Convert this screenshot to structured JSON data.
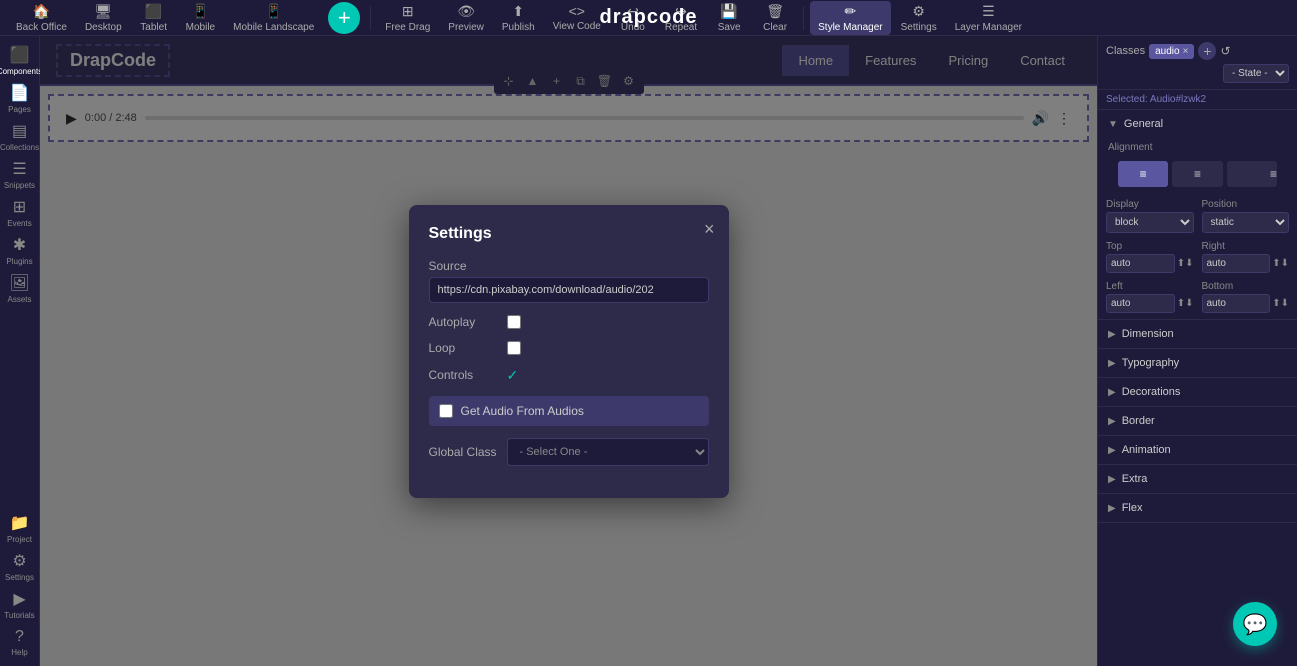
{
  "app": {
    "brand": "drapcode",
    "add_icon": "+"
  },
  "toolbar": {
    "items": [
      {
        "id": "back-office",
        "label": "Back Office",
        "icon": "🏠"
      },
      {
        "id": "desktop",
        "label": "Desktop",
        "icon": "🖥"
      },
      {
        "id": "tablet",
        "label": "Tablet",
        "icon": "⬛"
      },
      {
        "id": "mobile",
        "label": "Mobile",
        "icon": "📱"
      },
      {
        "id": "mobile-landscape",
        "label": "Mobile Landscape",
        "icon": "📱"
      },
      {
        "id": "free-drag",
        "label": "Free Drag",
        "icon": "⊞"
      },
      {
        "id": "preview",
        "label": "Preview",
        "icon": "👁"
      },
      {
        "id": "publish",
        "label": "Publish",
        "icon": "⬆"
      },
      {
        "id": "view-code",
        "label": "View Code",
        "icon": "<>"
      },
      {
        "id": "undo",
        "label": "Undo",
        "icon": "↩"
      },
      {
        "id": "repeat",
        "label": "Repeat",
        "icon": "↪"
      },
      {
        "id": "save",
        "label": "Save",
        "icon": "💾"
      },
      {
        "id": "clear",
        "label": "Clear",
        "icon": "🗑"
      },
      {
        "id": "style-manager",
        "label": "Style Manager",
        "icon": "✏"
      },
      {
        "id": "settings",
        "label": "Settings",
        "icon": "⚙"
      },
      {
        "id": "layer-manager",
        "label": "Layer Manager",
        "icon": "☰"
      }
    ]
  },
  "left_sidebar": {
    "items": [
      {
        "id": "components",
        "label": "Components",
        "icon": "⬛"
      },
      {
        "id": "pages",
        "label": "Pages",
        "icon": "📄"
      },
      {
        "id": "collections",
        "label": "Collections",
        "icon": "▤"
      },
      {
        "id": "snippets",
        "label": "Snippets",
        "icon": "☰"
      },
      {
        "id": "events",
        "label": "Events",
        "icon": "⊞"
      },
      {
        "id": "plugins",
        "label": "Plugins",
        "icon": "✱"
      },
      {
        "id": "assets",
        "label": "Assets",
        "icon": "🖼"
      },
      {
        "id": "project",
        "label": "Project",
        "icon": "📁"
      },
      {
        "id": "global-settings",
        "label": "Settings",
        "icon": "⚙"
      },
      {
        "id": "tutorials",
        "label": "Tutorials",
        "icon": "▶"
      },
      {
        "id": "help",
        "label": "Help",
        "icon": "?"
      }
    ]
  },
  "canvas": {
    "brand": "DrapCode",
    "nav_links": [
      "Home",
      "Features",
      "Pricing",
      "Contact"
    ],
    "active_nav": "Home",
    "audio": {
      "time_current": "0:00",
      "time_total": "2:48"
    }
  },
  "right_panel": {
    "classes_label": "Classes",
    "state_label": "- State -",
    "class_tag": "audio",
    "selected_label": "Selected: Audio",
    "selected_id": "#lzwk2",
    "sections": [
      {
        "id": "general",
        "label": "General",
        "expanded": true
      },
      {
        "id": "alignment",
        "label": "Alignment",
        "is_alignment": true
      },
      {
        "id": "display",
        "label": "Display",
        "is_display": true
      },
      {
        "id": "position_section",
        "label": "Position",
        "is_position": true
      },
      {
        "id": "top-right",
        "label": "Top/Right",
        "is_top_right": true
      },
      {
        "id": "left-bottom",
        "label": "Left/Bottom",
        "is_left_bottom": true
      },
      {
        "id": "dimension",
        "label": "Dimension",
        "expanded": false
      },
      {
        "id": "typography",
        "label": "Typography",
        "expanded": false
      },
      {
        "id": "decorations",
        "label": "Decorations",
        "expanded": false
      },
      {
        "id": "border",
        "label": "Border",
        "expanded": false
      },
      {
        "id": "animation",
        "label": "Animation",
        "expanded": false
      },
      {
        "id": "extra",
        "label": "Extra",
        "expanded": false
      },
      {
        "id": "flex",
        "label": "Flex",
        "expanded": false
      }
    ],
    "alignment_options": [
      "left",
      "center",
      "right"
    ],
    "display_value": "block",
    "position_value": "static",
    "top_value": "auto",
    "right_value": "auto",
    "left_value": "auto",
    "bottom_value": "auto"
  },
  "settings_modal": {
    "title": "Settings",
    "fields": [
      {
        "id": "source",
        "label": "Source",
        "value": "https://cdn.pixabay.com/download/audio/202",
        "type": "text"
      },
      {
        "id": "autoplay",
        "label": "Autoplay",
        "type": "checkbox",
        "checked": false
      },
      {
        "id": "loop",
        "label": "Loop",
        "type": "checkbox",
        "checked": false
      },
      {
        "id": "controls",
        "label": "Controls",
        "type": "checkbox",
        "checked": true
      },
      {
        "id": "get-audio",
        "label": "Get Audio From Audios",
        "type": "checkbox-special",
        "checked": false
      },
      {
        "id": "global-class",
        "label": "Global Class",
        "placeholder": "- Select One -",
        "type": "select"
      }
    ],
    "close_icon": "×"
  },
  "chat_button": {
    "icon": "💬"
  }
}
